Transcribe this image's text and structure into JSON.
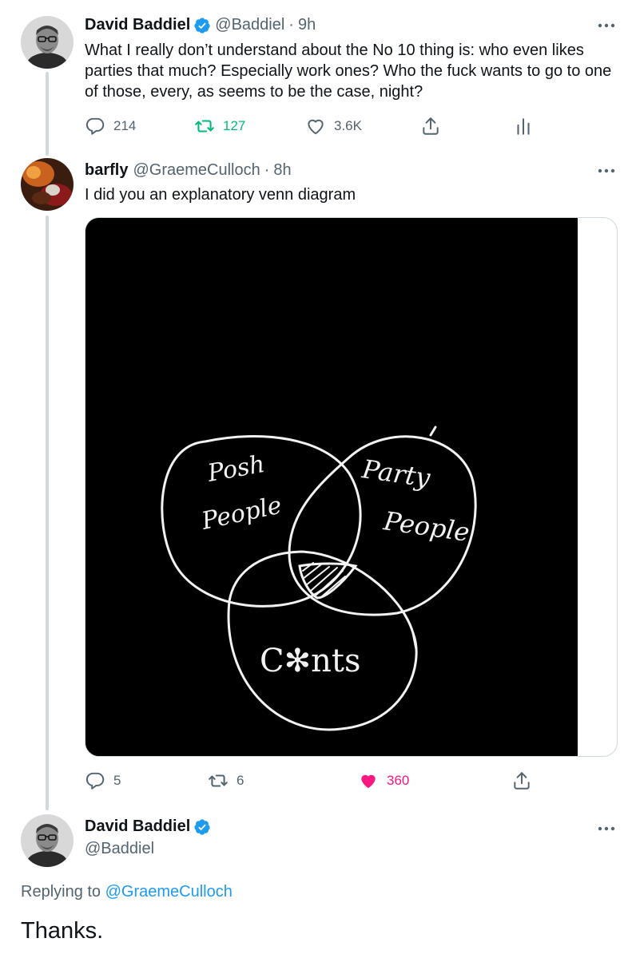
{
  "tweet1": {
    "name": "David Baddiel",
    "handle": "@Baddiel",
    "separator": "·",
    "time": "9h",
    "text_lines": [
      "What I really don’t understand about the No 10 thing is: who even likes",
      "parties that much? Especially work ones? Who the fuck wants to go to one",
      "of those, every, as seems to be the case, night?"
    ],
    "replies": "214",
    "retweets": "127",
    "likes": "3.6K"
  },
  "tweet2": {
    "name": "barfly",
    "handle": "@GraemeCulloch",
    "separator": "·",
    "time": "8h",
    "text": "I did you an explanatory venn diagram",
    "venn_labels": {
      "posh_1": "Posh",
      "posh_2": "People",
      "party_1": "Party",
      "party_2": "People",
      "cnts": "C✻nts"
    },
    "replies": "5",
    "retweets": "6",
    "likes": "360"
  },
  "tweet3": {
    "name": "David Baddiel",
    "handle": "@Baddiel",
    "replying_prefix": "Replying to ",
    "replying_to": "@GraemeCulloch",
    "text": "Thanks."
  },
  "colors": {
    "text": "#0f1419",
    "secondary": "#536471",
    "verified": "#1d9bf0",
    "retweet": "#00ba7c",
    "like": "#f91880",
    "thread_line": "#cfd9de"
  },
  "icons": [
    "verified-badge-icon",
    "more-icon",
    "reply-icon",
    "retweet-icon",
    "like-icon",
    "share-icon",
    "analytics-icon"
  ]
}
